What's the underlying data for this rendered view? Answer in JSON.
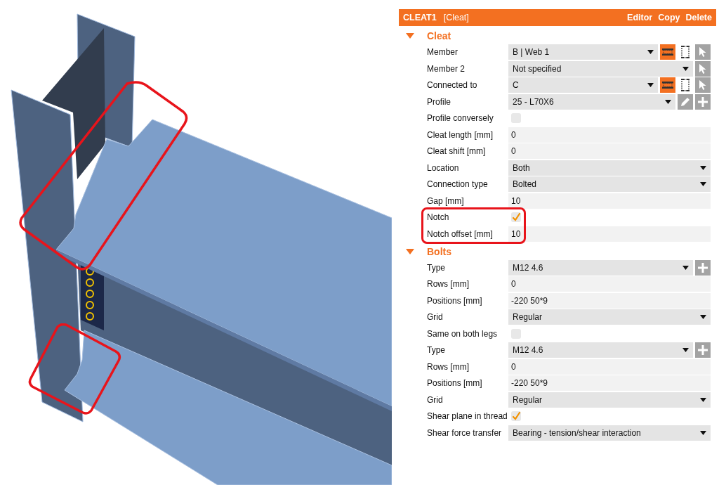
{
  "header": {
    "name": "CLEAT1",
    "type": "[Cleat]",
    "actions": [
      "Editor",
      "Copy",
      "Delete"
    ]
  },
  "sections": [
    {
      "title": "Cleat",
      "expanded": true,
      "rows": [
        {
          "label": "Member",
          "kind": "select",
          "value": "B | Web 1",
          "highlighted": false,
          "tools": [
            {
              "kind": "beam"
            },
            {
              "kind": "frame"
            },
            {
              "kind": "pick"
            }
          ]
        },
        {
          "label": "Member 2",
          "kind": "select",
          "value": "Not specified",
          "highlighted": false,
          "tools": [
            {
              "kind": "pick"
            }
          ]
        },
        {
          "label": "Connected to",
          "kind": "select",
          "value": "C",
          "highlighted": false,
          "tools": [
            {
              "kind": "beam"
            },
            {
              "kind": "frame"
            },
            {
              "kind": "pick"
            }
          ]
        },
        {
          "label": "Profile",
          "kind": "select",
          "value": "25 - L70X6",
          "highlighted": false,
          "tools": [
            {
              "kind": "edit"
            },
            {
              "kind": "add"
            }
          ]
        },
        {
          "label": "Profile conversely",
          "kind": "checkbox",
          "checked": false,
          "highlighted": false
        },
        {
          "label": "Cleat length [mm]",
          "kind": "text",
          "value": "0",
          "highlighted": false
        },
        {
          "label": "Cleat shift [mm]",
          "kind": "text",
          "value": "0",
          "highlighted": false
        },
        {
          "label": "Location",
          "kind": "select",
          "value": "Both",
          "highlighted": false
        },
        {
          "label": "Connection type",
          "kind": "select",
          "value": "Bolted",
          "highlighted": false
        },
        {
          "label": "Gap [mm]",
          "kind": "text",
          "value": "10",
          "highlighted": false
        },
        {
          "label": "Notch",
          "kind": "checkbox",
          "checked": true,
          "highlighted": true
        },
        {
          "label": "Notch offset [mm]",
          "kind": "text",
          "value": "10",
          "highlighted": true
        }
      ]
    },
    {
      "title": "Bolts",
      "expanded": true,
      "rows": [
        {
          "label": "Type",
          "kind": "select",
          "value": "M12 4.6",
          "highlighted": false,
          "tools": [
            {
              "kind": "add"
            }
          ]
        },
        {
          "label": "Rows [mm]",
          "kind": "text",
          "value": "0",
          "highlighted": false
        },
        {
          "label": "Positions [mm]",
          "kind": "text",
          "value": "-220 50*9",
          "highlighted": false
        },
        {
          "label": "Grid",
          "kind": "select",
          "value": "Regular",
          "highlighted": false
        },
        {
          "label": "Same on both legs",
          "kind": "checkbox",
          "checked": false,
          "highlighted": false
        },
        {
          "label": "Type",
          "kind": "select",
          "value": "M12 4.6",
          "highlighted": false,
          "tools": [
            {
              "kind": "add"
            }
          ]
        },
        {
          "label": "Rows [mm]",
          "kind": "text",
          "value": "0",
          "highlighted": false
        },
        {
          "label": "Positions [mm]",
          "kind": "text",
          "value": "-220 50*9",
          "highlighted": false
        },
        {
          "label": "Grid",
          "kind": "select",
          "value": "Regular",
          "highlighted": false
        },
        {
          "label": "Shear plane in thread",
          "kind": "checkbox",
          "checked": true,
          "highlighted": false
        },
        {
          "label": "Shear force transfer",
          "kind": "select",
          "value": "Bearing - tension/shear interaction",
          "highlighted": false
        }
      ]
    }
  ]
}
